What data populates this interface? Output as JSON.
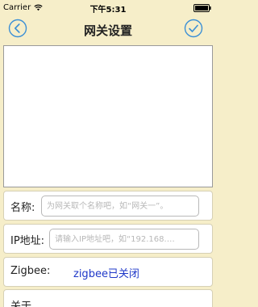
{
  "status_bar": {
    "carrier": "Carrier",
    "time": "下午5:31"
  },
  "nav": {
    "title": "网关设置",
    "back_icon": "chevron-left-circle-icon",
    "confirm_icon": "check-circle-icon",
    "accent_color": "#3a8fd6"
  },
  "form": {
    "name": {
      "label": "名称:",
      "value": "",
      "placeholder": "为网关取个名称吧，如“网关一”。"
    },
    "ip": {
      "label": "IP地址:",
      "value": "",
      "placeholder": "请输入IP地址吧，如“192.168.…"
    },
    "zigbee": {
      "label": "Zigbee:",
      "status": "zigbee已关闭",
      "status_color": "#1f38c8"
    },
    "about": {
      "label": "关于"
    }
  }
}
